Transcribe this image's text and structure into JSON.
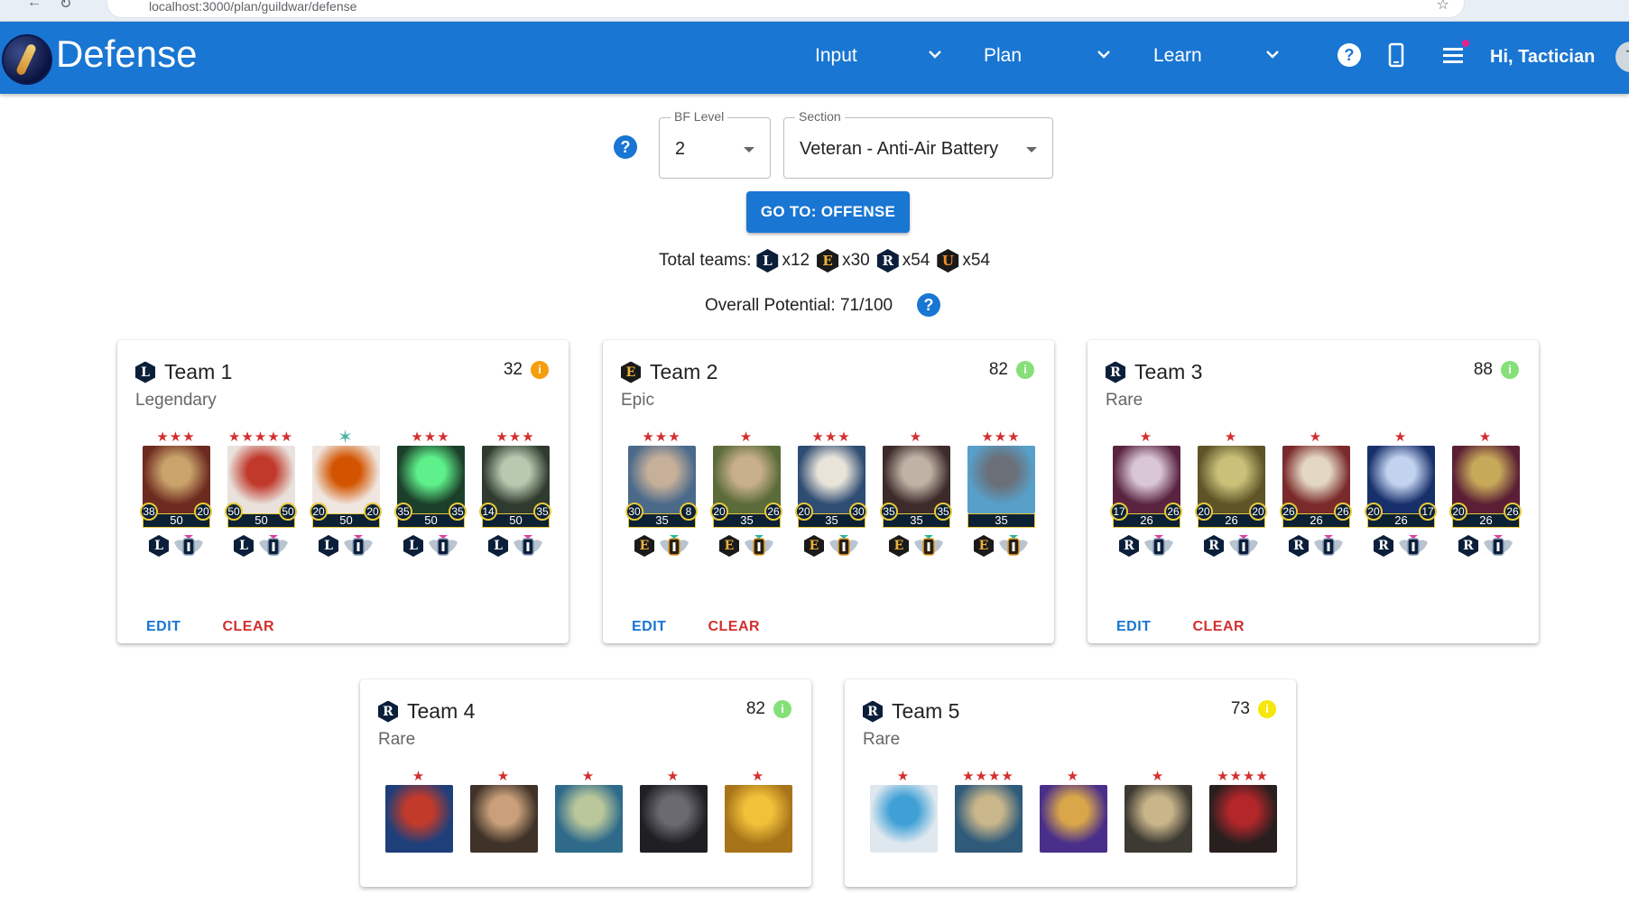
{
  "browser": {
    "url": "localhost:3000/plan/guildwar/defense"
  },
  "appbar": {
    "title": "Defense",
    "menus": [
      {
        "label": "Input"
      },
      {
        "label": "Plan"
      },
      {
        "label": "Learn"
      }
    ],
    "greeting": "Hi, Tactician",
    "avatar_initial": "T",
    "color": "#1976d2"
  },
  "controls": {
    "bf_level": {
      "label": "BF Level",
      "value": "2"
    },
    "section": {
      "label": "Section",
      "value": "Veteran - Anti-Air Battery"
    },
    "go_button": "GO TO: OFFENSE"
  },
  "totals": {
    "label": "Total teams:",
    "items": [
      {
        "rank": "L",
        "count": "x12"
      },
      {
        "rank": "E",
        "count": "x30"
      },
      {
        "rank": "R",
        "count": "x54"
      },
      {
        "rank": "U",
        "count": "x54"
      }
    ]
  },
  "potential": "Overall Potential: 71/100",
  "actions": {
    "edit": "EDIT",
    "clear": "CLEAR"
  },
  "teams": [
    {
      "name": "Team 1",
      "rarity": "Legendary",
      "rank": "L",
      "score": "32",
      "score_color": "#f59e0b",
      "units": [
        {
          "stars": "★★★",
          "left": "38",
          "mid": "50",
          "right": "20",
          "rank": "L",
          "colors": [
            "#6d2a1f",
            "#c9a36b"
          ]
        },
        {
          "stars": "★★★★★",
          "left": "50",
          "mid": "50",
          "right": "50",
          "rank": "L",
          "colors": [
            "#e9e2dc",
            "#c0392b"
          ]
        },
        {
          "stars": "✶",
          "left": "20",
          "mid": "50",
          "right": "20",
          "rank": "L",
          "colors": [
            "#f0e6e0",
            "#d35400"
          ]
        },
        {
          "stars": "★★★",
          "left": "35",
          "mid": "50",
          "right": "35",
          "rank": "L",
          "colors": [
            "#1c3f2a",
            "#5ef08a"
          ]
        },
        {
          "stars": "★★★",
          "left": "14",
          "mid": "50",
          "right": "35",
          "rank": "L",
          "colors": [
            "#2f3b2f",
            "#b9c9b0"
          ]
        }
      ],
      "show_actions": true
    },
    {
      "name": "Team 2",
      "rarity": "Epic",
      "rank": "E",
      "score": "82",
      "score_color": "#86e07a",
      "units": [
        {
          "stars": "★★★",
          "left": "30",
          "mid": "35",
          "right": "8",
          "rank": "E",
          "colors": [
            "#4b6a8a",
            "#c7b09a"
          ]
        },
        {
          "stars": "★",
          "left": "20",
          "mid": "35",
          "right": "26",
          "rank": "E",
          "colors": [
            "#5b6b3a",
            "#c9b08c"
          ]
        },
        {
          "stars": "★★★",
          "left": "20",
          "mid": "35",
          "right": "30",
          "rank": "E",
          "colors": [
            "#2f4d73",
            "#e9e4da"
          ]
        },
        {
          "stars": "★",
          "left": "35",
          "mid": "35",
          "right": "35",
          "rank": "E",
          "colors": [
            "#3d2a2a",
            "#bfb3a5"
          ]
        },
        {
          "stars": "★★★",
          "left": "",
          "mid": "35",
          "right": "",
          "rank": "E",
          "colors": [
            "#58a0c9",
            "#6a6f78"
          ]
        }
      ],
      "show_actions": true
    },
    {
      "name": "Team 3",
      "rarity": "Rare",
      "rank": "R",
      "score": "88",
      "score_color": "#86e07a",
      "units": [
        {
          "stars": "★",
          "left": "17",
          "mid": "26",
          "right": "26",
          "rank": "R",
          "colors": [
            "#5a2440",
            "#d9c6d6"
          ]
        },
        {
          "stars": "★",
          "left": "20",
          "mid": "26",
          "right": "20",
          "rank": "R",
          "colors": [
            "#5e5427",
            "#c9c07a"
          ]
        },
        {
          "stars": "★",
          "left": "26",
          "mid": "26",
          "right": "26",
          "rank": "R",
          "colors": [
            "#7a2a2a",
            "#e3d6c2"
          ]
        },
        {
          "stars": "★",
          "left": "20",
          "mid": "26",
          "right": "17",
          "rank": "R",
          "colors": [
            "#172f6a",
            "#c2d3ef"
          ]
        },
        {
          "stars": "★",
          "left": "20",
          "mid": "26",
          "right": "26",
          "rank": "R",
          "colors": [
            "#5a1f34",
            "#c7a95a"
          ]
        }
      ],
      "show_actions": true
    },
    {
      "name": "Team 4",
      "rarity": "Rare",
      "rank": "R",
      "score": "82",
      "score_color": "#86e07a",
      "units": [
        {
          "stars": "★",
          "colors": [
            "#1f3f7a",
            "#c23a2a"
          ]
        },
        {
          "stars": "★",
          "colors": [
            "#3f3229",
            "#c9a07a"
          ]
        },
        {
          "stars": "★",
          "colors": [
            "#2f6a8a",
            "#b9c79a"
          ]
        },
        {
          "stars": "★",
          "colors": [
            "#1f1f24",
            "#6a6a70"
          ]
        },
        {
          "stars": "★",
          "colors": [
            "#a8741a",
            "#f0c23a"
          ]
        }
      ],
      "show_actions": false
    },
    {
      "name": "Team 5",
      "rarity": "Rare",
      "rank": "R",
      "score": "73",
      "score_color": "#f5e60b",
      "units": [
        {
          "stars": "★",
          "colors": [
            "#dfe8ef",
            "#3fa0d6"
          ]
        },
        {
          "stars": "★★★★",
          "colors": [
            "#2f5a7a",
            "#c9b68a"
          ]
        },
        {
          "stars": "★",
          "colors": [
            "#4a2f8a",
            "#d9a64a"
          ]
        },
        {
          "stars": "★",
          "colors": [
            "#3d3a33",
            "#c9b58a"
          ]
        },
        {
          "stars": "★★★★",
          "colors": [
            "#2a1f1f",
            "#b3262a"
          ]
        }
      ],
      "show_actions": false
    }
  ]
}
